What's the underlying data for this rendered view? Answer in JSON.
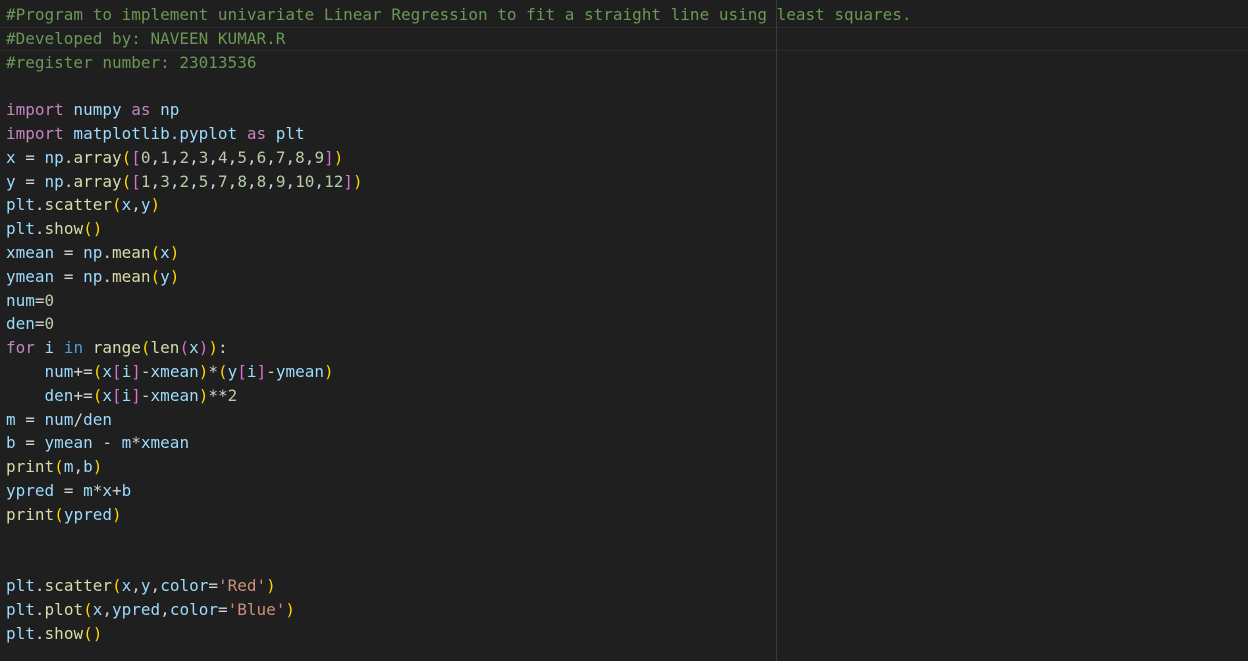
{
  "editor": {
    "lines": [
      [
        {
          "t": "#Program to implement univariate Linear Regression to fit a straight line using least squares.",
          "c": "c"
        }
      ],
      [
        {
          "t": "#Developed by: NAVEEN KUMAR.R",
          "c": "c"
        }
      ],
      [
        {
          "t": "#register number: 23013536",
          "c": "c"
        }
      ],
      [],
      [
        {
          "t": "import",
          "c": "k"
        },
        {
          "t": " numpy ",
          "c": "v"
        },
        {
          "t": "as",
          "c": "k"
        },
        {
          "t": " np",
          "c": "v"
        }
      ],
      [
        {
          "t": "import",
          "c": "k"
        },
        {
          "t": " matplotlib.pyplot ",
          "c": "v"
        },
        {
          "t": "as",
          "c": "k"
        },
        {
          "t": " plt",
          "c": "v"
        }
      ],
      [
        {
          "t": "x",
          "c": "v"
        },
        {
          "t": " = ",
          "c": "o"
        },
        {
          "t": "np",
          "c": "v"
        },
        {
          "t": ".",
          "c": "o"
        },
        {
          "t": "array",
          "c": "f"
        },
        {
          "t": "(",
          "c": "b1"
        },
        {
          "t": "[",
          "c": "b2"
        },
        {
          "t": "0",
          "c": "n"
        },
        {
          "t": ",",
          "c": "o"
        },
        {
          "t": "1",
          "c": "n"
        },
        {
          "t": ",",
          "c": "o"
        },
        {
          "t": "2",
          "c": "n"
        },
        {
          "t": ",",
          "c": "o"
        },
        {
          "t": "3",
          "c": "n"
        },
        {
          "t": ",",
          "c": "o"
        },
        {
          "t": "4",
          "c": "n"
        },
        {
          "t": ",",
          "c": "o"
        },
        {
          "t": "5",
          "c": "n"
        },
        {
          "t": ",",
          "c": "o"
        },
        {
          "t": "6",
          "c": "n"
        },
        {
          "t": ",",
          "c": "o"
        },
        {
          "t": "7",
          "c": "n"
        },
        {
          "t": ",",
          "c": "o"
        },
        {
          "t": "8",
          "c": "n"
        },
        {
          "t": ",",
          "c": "o"
        },
        {
          "t": "9",
          "c": "n"
        },
        {
          "t": "]",
          "c": "b2"
        },
        {
          "t": ")",
          "c": "b1"
        }
      ],
      [
        {
          "t": "y",
          "c": "v"
        },
        {
          "t": " = ",
          "c": "o"
        },
        {
          "t": "np",
          "c": "v"
        },
        {
          "t": ".",
          "c": "o"
        },
        {
          "t": "array",
          "c": "f"
        },
        {
          "t": "(",
          "c": "b1"
        },
        {
          "t": "[",
          "c": "b2"
        },
        {
          "t": "1",
          "c": "n"
        },
        {
          "t": ",",
          "c": "o"
        },
        {
          "t": "3",
          "c": "n"
        },
        {
          "t": ",",
          "c": "o"
        },
        {
          "t": "2",
          "c": "n"
        },
        {
          "t": ",",
          "c": "o"
        },
        {
          "t": "5",
          "c": "n"
        },
        {
          "t": ",",
          "c": "o"
        },
        {
          "t": "7",
          "c": "n"
        },
        {
          "t": ",",
          "c": "o"
        },
        {
          "t": "8",
          "c": "n"
        },
        {
          "t": ",",
          "c": "o"
        },
        {
          "t": "8",
          "c": "n"
        },
        {
          "t": ",",
          "c": "o"
        },
        {
          "t": "9",
          "c": "n"
        },
        {
          "t": ",",
          "c": "o"
        },
        {
          "t": "10",
          "c": "n"
        },
        {
          "t": ",",
          "c": "o"
        },
        {
          "t": "12",
          "c": "n"
        },
        {
          "t": "]",
          "c": "b2"
        },
        {
          "t": ")",
          "c": "b1"
        }
      ],
      [
        {
          "t": "plt",
          "c": "v"
        },
        {
          "t": ".",
          "c": "o"
        },
        {
          "t": "scatter",
          "c": "f"
        },
        {
          "t": "(",
          "c": "b1"
        },
        {
          "t": "x",
          "c": "v"
        },
        {
          "t": ",",
          "c": "o"
        },
        {
          "t": "y",
          "c": "v"
        },
        {
          "t": ")",
          "c": "b1"
        }
      ],
      [
        {
          "t": "plt",
          "c": "v"
        },
        {
          "t": ".",
          "c": "o"
        },
        {
          "t": "show",
          "c": "f"
        },
        {
          "t": "()",
          "c": "b1"
        }
      ],
      [
        {
          "t": "xmean",
          "c": "v"
        },
        {
          "t": " = ",
          "c": "o"
        },
        {
          "t": "np",
          "c": "v"
        },
        {
          "t": ".",
          "c": "o"
        },
        {
          "t": "mean",
          "c": "f"
        },
        {
          "t": "(",
          "c": "b1"
        },
        {
          "t": "x",
          "c": "v"
        },
        {
          "t": ")",
          "c": "b1"
        }
      ],
      [
        {
          "t": "ymean",
          "c": "v"
        },
        {
          "t": " = ",
          "c": "o"
        },
        {
          "t": "np",
          "c": "v"
        },
        {
          "t": ".",
          "c": "o"
        },
        {
          "t": "mean",
          "c": "f"
        },
        {
          "t": "(",
          "c": "b1"
        },
        {
          "t": "y",
          "c": "v"
        },
        {
          "t": ")",
          "c": "b1"
        }
      ],
      [
        {
          "t": "num",
          "c": "v"
        },
        {
          "t": "=",
          "c": "o"
        },
        {
          "t": "0",
          "c": "n"
        }
      ],
      [
        {
          "t": "den",
          "c": "v"
        },
        {
          "t": "=",
          "c": "o"
        },
        {
          "t": "0",
          "c": "n"
        }
      ],
      [
        {
          "t": "for",
          "c": "k"
        },
        {
          "t": " i ",
          "c": "v"
        },
        {
          "t": "in",
          "c": "kb"
        },
        {
          "t": " ",
          "c": "o"
        },
        {
          "t": "range",
          "c": "f"
        },
        {
          "t": "(",
          "c": "b1"
        },
        {
          "t": "len",
          "c": "f"
        },
        {
          "t": "(",
          "c": "b2"
        },
        {
          "t": "x",
          "c": "v"
        },
        {
          "t": ")",
          "c": "b2"
        },
        {
          "t": ")",
          "c": "b1"
        },
        {
          "t": ":",
          "c": "o"
        }
      ],
      [
        {
          "t": "    num",
          "c": "v"
        },
        {
          "t": "+=",
          "c": "o"
        },
        {
          "t": "(",
          "c": "b1"
        },
        {
          "t": "x",
          "c": "v"
        },
        {
          "t": "[",
          "c": "b2"
        },
        {
          "t": "i",
          "c": "v"
        },
        {
          "t": "]",
          "c": "b2"
        },
        {
          "t": "-",
          "c": "o"
        },
        {
          "t": "xmean",
          "c": "v"
        },
        {
          "t": ")",
          "c": "b1"
        },
        {
          "t": "*",
          "c": "o"
        },
        {
          "t": "(",
          "c": "b1"
        },
        {
          "t": "y",
          "c": "v"
        },
        {
          "t": "[",
          "c": "b2"
        },
        {
          "t": "i",
          "c": "v"
        },
        {
          "t": "]",
          "c": "b2"
        },
        {
          "t": "-",
          "c": "o"
        },
        {
          "t": "ymean",
          "c": "v"
        },
        {
          "t": ")",
          "c": "b1"
        }
      ],
      [
        {
          "t": "    den",
          "c": "v"
        },
        {
          "t": "+=",
          "c": "o"
        },
        {
          "t": "(",
          "c": "b1"
        },
        {
          "t": "x",
          "c": "v"
        },
        {
          "t": "[",
          "c": "b2"
        },
        {
          "t": "i",
          "c": "v"
        },
        {
          "t": "]",
          "c": "b2"
        },
        {
          "t": "-",
          "c": "o"
        },
        {
          "t": "xmean",
          "c": "v"
        },
        {
          "t": ")",
          "c": "b1"
        },
        {
          "t": "**",
          "c": "o"
        },
        {
          "t": "2",
          "c": "n"
        }
      ],
      [
        {
          "t": "m",
          "c": "v"
        },
        {
          "t": " = ",
          "c": "o"
        },
        {
          "t": "num",
          "c": "v"
        },
        {
          "t": "/",
          "c": "o"
        },
        {
          "t": "den",
          "c": "v"
        }
      ],
      [
        {
          "t": "b",
          "c": "v"
        },
        {
          "t": " = ",
          "c": "o"
        },
        {
          "t": "ymean",
          "c": "v"
        },
        {
          "t": " - ",
          "c": "o"
        },
        {
          "t": "m",
          "c": "v"
        },
        {
          "t": "*",
          "c": "o"
        },
        {
          "t": "xmean",
          "c": "v"
        }
      ],
      [
        {
          "t": "print",
          "c": "f"
        },
        {
          "t": "(",
          "c": "b1"
        },
        {
          "t": "m",
          "c": "v"
        },
        {
          "t": ",",
          "c": "o"
        },
        {
          "t": "b",
          "c": "v"
        },
        {
          "t": ")",
          "c": "b1"
        }
      ],
      [
        {
          "t": "ypred",
          "c": "v"
        },
        {
          "t": " = ",
          "c": "o"
        },
        {
          "t": "m",
          "c": "v"
        },
        {
          "t": "*",
          "c": "o"
        },
        {
          "t": "x",
          "c": "v"
        },
        {
          "t": "+",
          "c": "o"
        },
        {
          "t": "b",
          "c": "v"
        }
      ],
      [
        {
          "t": "print",
          "c": "f"
        },
        {
          "t": "(",
          "c": "b1"
        },
        {
          "t": "ypred",
          "c": "v"
        },
        {
          "t": ")",
          "c": "b1"
        }
      ],
      [],
      [],
      [
        {
          "t": "plt",
          "c": "v"
        },
        {
          "t": ".",
          "c": "o"
        },
        {
          "t": "scatter",
          "c": "f"
        },
        {
          "t": "(",
          "c": "b1"
        },
        {
          "t": "x",
          "c": "v"
        },
        {
          "t": ",",
          "c": "o"
        },
        {
          "t": "y",
          "c": "v"
        },
        {
          "t": ",",
          "c": "o"
        },
        {
          "t": "color",
          "c": "v"
        },
        {
          "t": "=",
          "c": "o"
        },
        {
          "t": "'Red'",
          "c": "s"
        },
        {
          "t": ")",
          "c": "b1"
        }
      ],
      [
        {
          "t": "plt",
          "c": "v"
        },
        {
          "t": ".",
          "c": "o"
        },
        {
          "t": "plot",
          "c": "f"
        },
        {
          "t": "(",
          "c": "b1"
        },
        {
          "t": "x",
          "c": "v"
        },
        {
          "t": ",",
          "c": "o"
        },
        {
          "t": "ypred",
          "c": "v"
        },
        {
          "t": ",",
          "c": "o"
        },
        {
          "t": "color",
          "c": "v"
        },
        {
          "t": "=",
          "c": "o"
        },
        {
          "t": "'Blue'",
          "c": "s"
        },
        {
          "t": ")",
          "c": "b1"
        }
      ],
      [
        {
          "t": "plt",
          "c": "v"
        },
        {
          "t": ".",
          "c": "o"
        },
        {
          "t": "show",
          "c": "f"
        },
        {
          "t": "()",
          "c": "b1"
        }
      ]
    ]
  },
  "theme": {
    "background": "#1f1f1f",
    "comment": "#6a9955",
    "keyword": "#c586c0",
    "variable": "#9cdcfe",
    "function": "#dcdcaa",
    "number": "#b5cea8",
    "string": "#ce9178"
  }
}
